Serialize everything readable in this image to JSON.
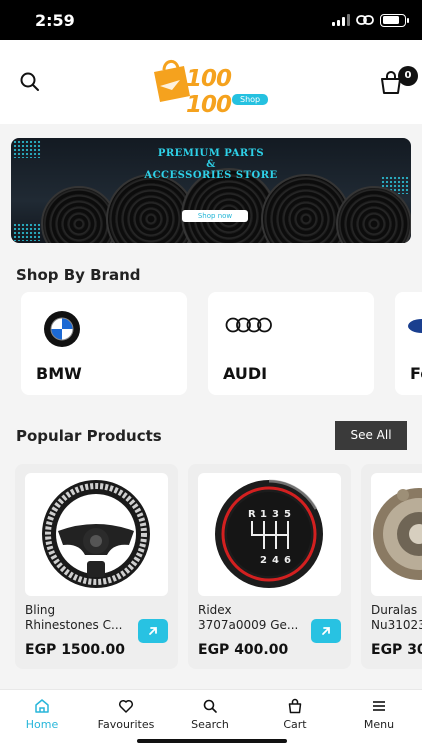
{
  "status_bar": {
    "time": "2:59",
    "battery_level": 0.8
  },
  "header": {
    "logo_text": "100 100",
    "logo_tag": "Shop",
    "cart_count": "0",
    "search_icon": "search-icon",
    "cart_icon": "shopping-bag-icon"
  },
  "banner": {
    "title_line1": "PREMIUM PARTS",
    "title_line2": "&",
    "title_line3": "ACCESSORIES STORE",
    "button_label": "Shop now"
  },
  "brands": {
    "section_title": "Shop By Brand",
    "items": [
      {
        "name": "BMW",
        "icon": "bmw-logo-icon"
      },
      {
        "name": "AUDI",
        "icon": "audi-logo-icon"
      },
      {
        "name": "Fo",
        "icon": "ford-logo-icon"
      }
    ]
  },
  "popular": {
    "section_title": "Popular Products",
    "see_all_label": "See All",
    "items": [
      {
        "name_line1": "Bling",
        "name_line2": "Rhinestones C...",
        "price": "EGP 1500.00",
        "image": "steering-wheel-cover"
      },
      {
        "name_line1": "Ridex",
        "name_line2": "3707a0009 Ge...",
        "price": "EGP 400.00",
        "image": "gear-knob"
      },
      {
        "name_line1": "Duralas",
        "name_line2": "Nu31023",
        "price": "EGP 30",
        "image": "clutch-kit"
      }
    ]
  },
  "bottom_nav": {
    "items": [
      {
        "label": "Home",
        "icon": "home-icon",
        "active": true
      },
      {
        "label": "Favourites",
        "icon": "heart-icon",
        "active": false
      },
      {
        "label": "Search",
        "icon": "search-icon",
        "active": false
      },
      {
        "label": "Cart",
        "icon": "shopping-bag-icon",
        "active": false
      },
      {
        "label": "Menu",
        "icon": "menu-icon",
        "active": false
      }
    ]
  },
  "colors": {
    "accent": "#28c2e2",
    "logo_orange": "#f5a21e",
    "dark_button": "#3a3a3a"
  }
}
